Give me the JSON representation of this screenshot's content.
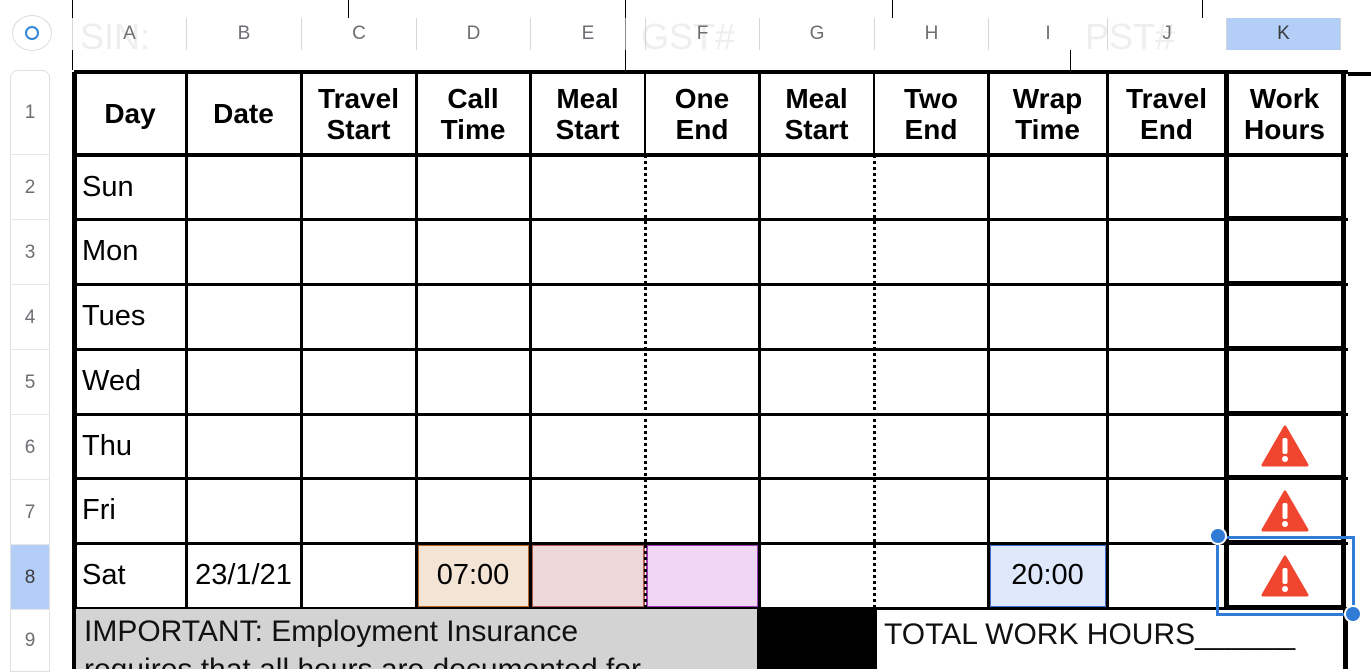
{
  "ghost_labels": [
    "SIN:",
    "GST#",
    "PST#"
  ],
  "column_headers": [
    "A",
    "B",
    "C",
    "D",
    "E",
    "F",
    "G",
    "H",
    "I",
    "J",
    "K"
  ],
  "selected_column": "K",
  "row_headers": [
    "1",
    "2",
    "3",
    "4",
    "5",
    "6",
    "7",
    "8",
    "9"
  ],
  "selected_row": "8",
  "table": {
    "headers": [
      [
        "Day"
      ],
      [
        "Date"
      ],
      [
        "Travel",
        "Start"
      ],
      [
        "Call",
        "Time"
      ],
      [
        "Meal",
        "Start"
      ],
      [
        "One",
        "End"
      ],
      [
        "Meal",
        "Start"
      ],
      [
        "Two",
        "End"
      ],
      [
        "Wrap",
        "Time"
      ],
      [
        "Travel",
        "End"
      ],
      [
        "Work",
        "Hours"
      ]
    ],
    "days": [
      "Sun",
      "Mon",
      "Tues",
      "Wed",
      "Thu",
      "Fri",
      "Sat"
    ],
    "sat_date": "23/1/21",
    "sat_call_time": "07:00",
    "sat_wrap_time": "20:00"
  },
  "warning_rows": [
    "Thu",
    "Fri",
    "Sat"
  ],
  "important_note": "IMPORTANT: Employment Insurance",
  "important_note_2": "requires that all hours are documented for",
  "total_label": "TOTAL WORK HOURS______",
  "colors": {
    "selection": "#2f7bd6",
    "header_highlight": "#b3cff7",
    "call_time_fill": "#f3e4d6",
    "call_time_border": "#b56a2c",
    "meal_fill": "#ecd8d8",
    "meal_border": "#b45a4a",
    "one_end_fill": "#f0d8f4",
    "one_end_border": "#9b3fb5",
    "wrap_fill": "#dfe8fb",
    "wrap_border": "#3f6fc9",
    "warning": "#f0452f",
    "note_bg": "#d3d3d3"
  }
}
